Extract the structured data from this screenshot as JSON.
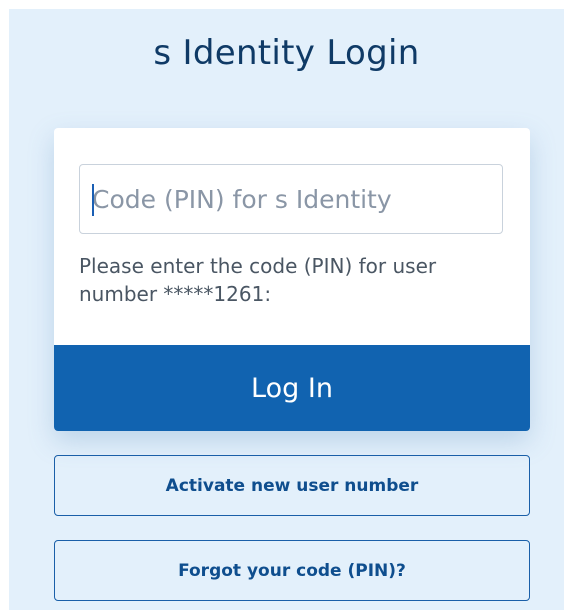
{
  "page": {
    "title": "s Identity Login"
  },
  "login_form": {
    "pin_input": {
      "value": "",
      "placeholder": "Code (PIN) for s Identity"
    },
    "hint": "Please enter the code (PIN) for user number *****1261:",
    "submit_label": "Log In"
  },
  "secondary_actions": {
    "activate_label": "Activate new user number",
    "forgot_label": "Forgot your code (PIN)?"
  },
  "colors": {
    "background": "#e3f0fb",
    "title": "#0f3a66",
    "primary_button": "#1163b0",
    "outline_border": "#1a5fa8",
    "outline_text": "#0f4e8e"
  }
}
